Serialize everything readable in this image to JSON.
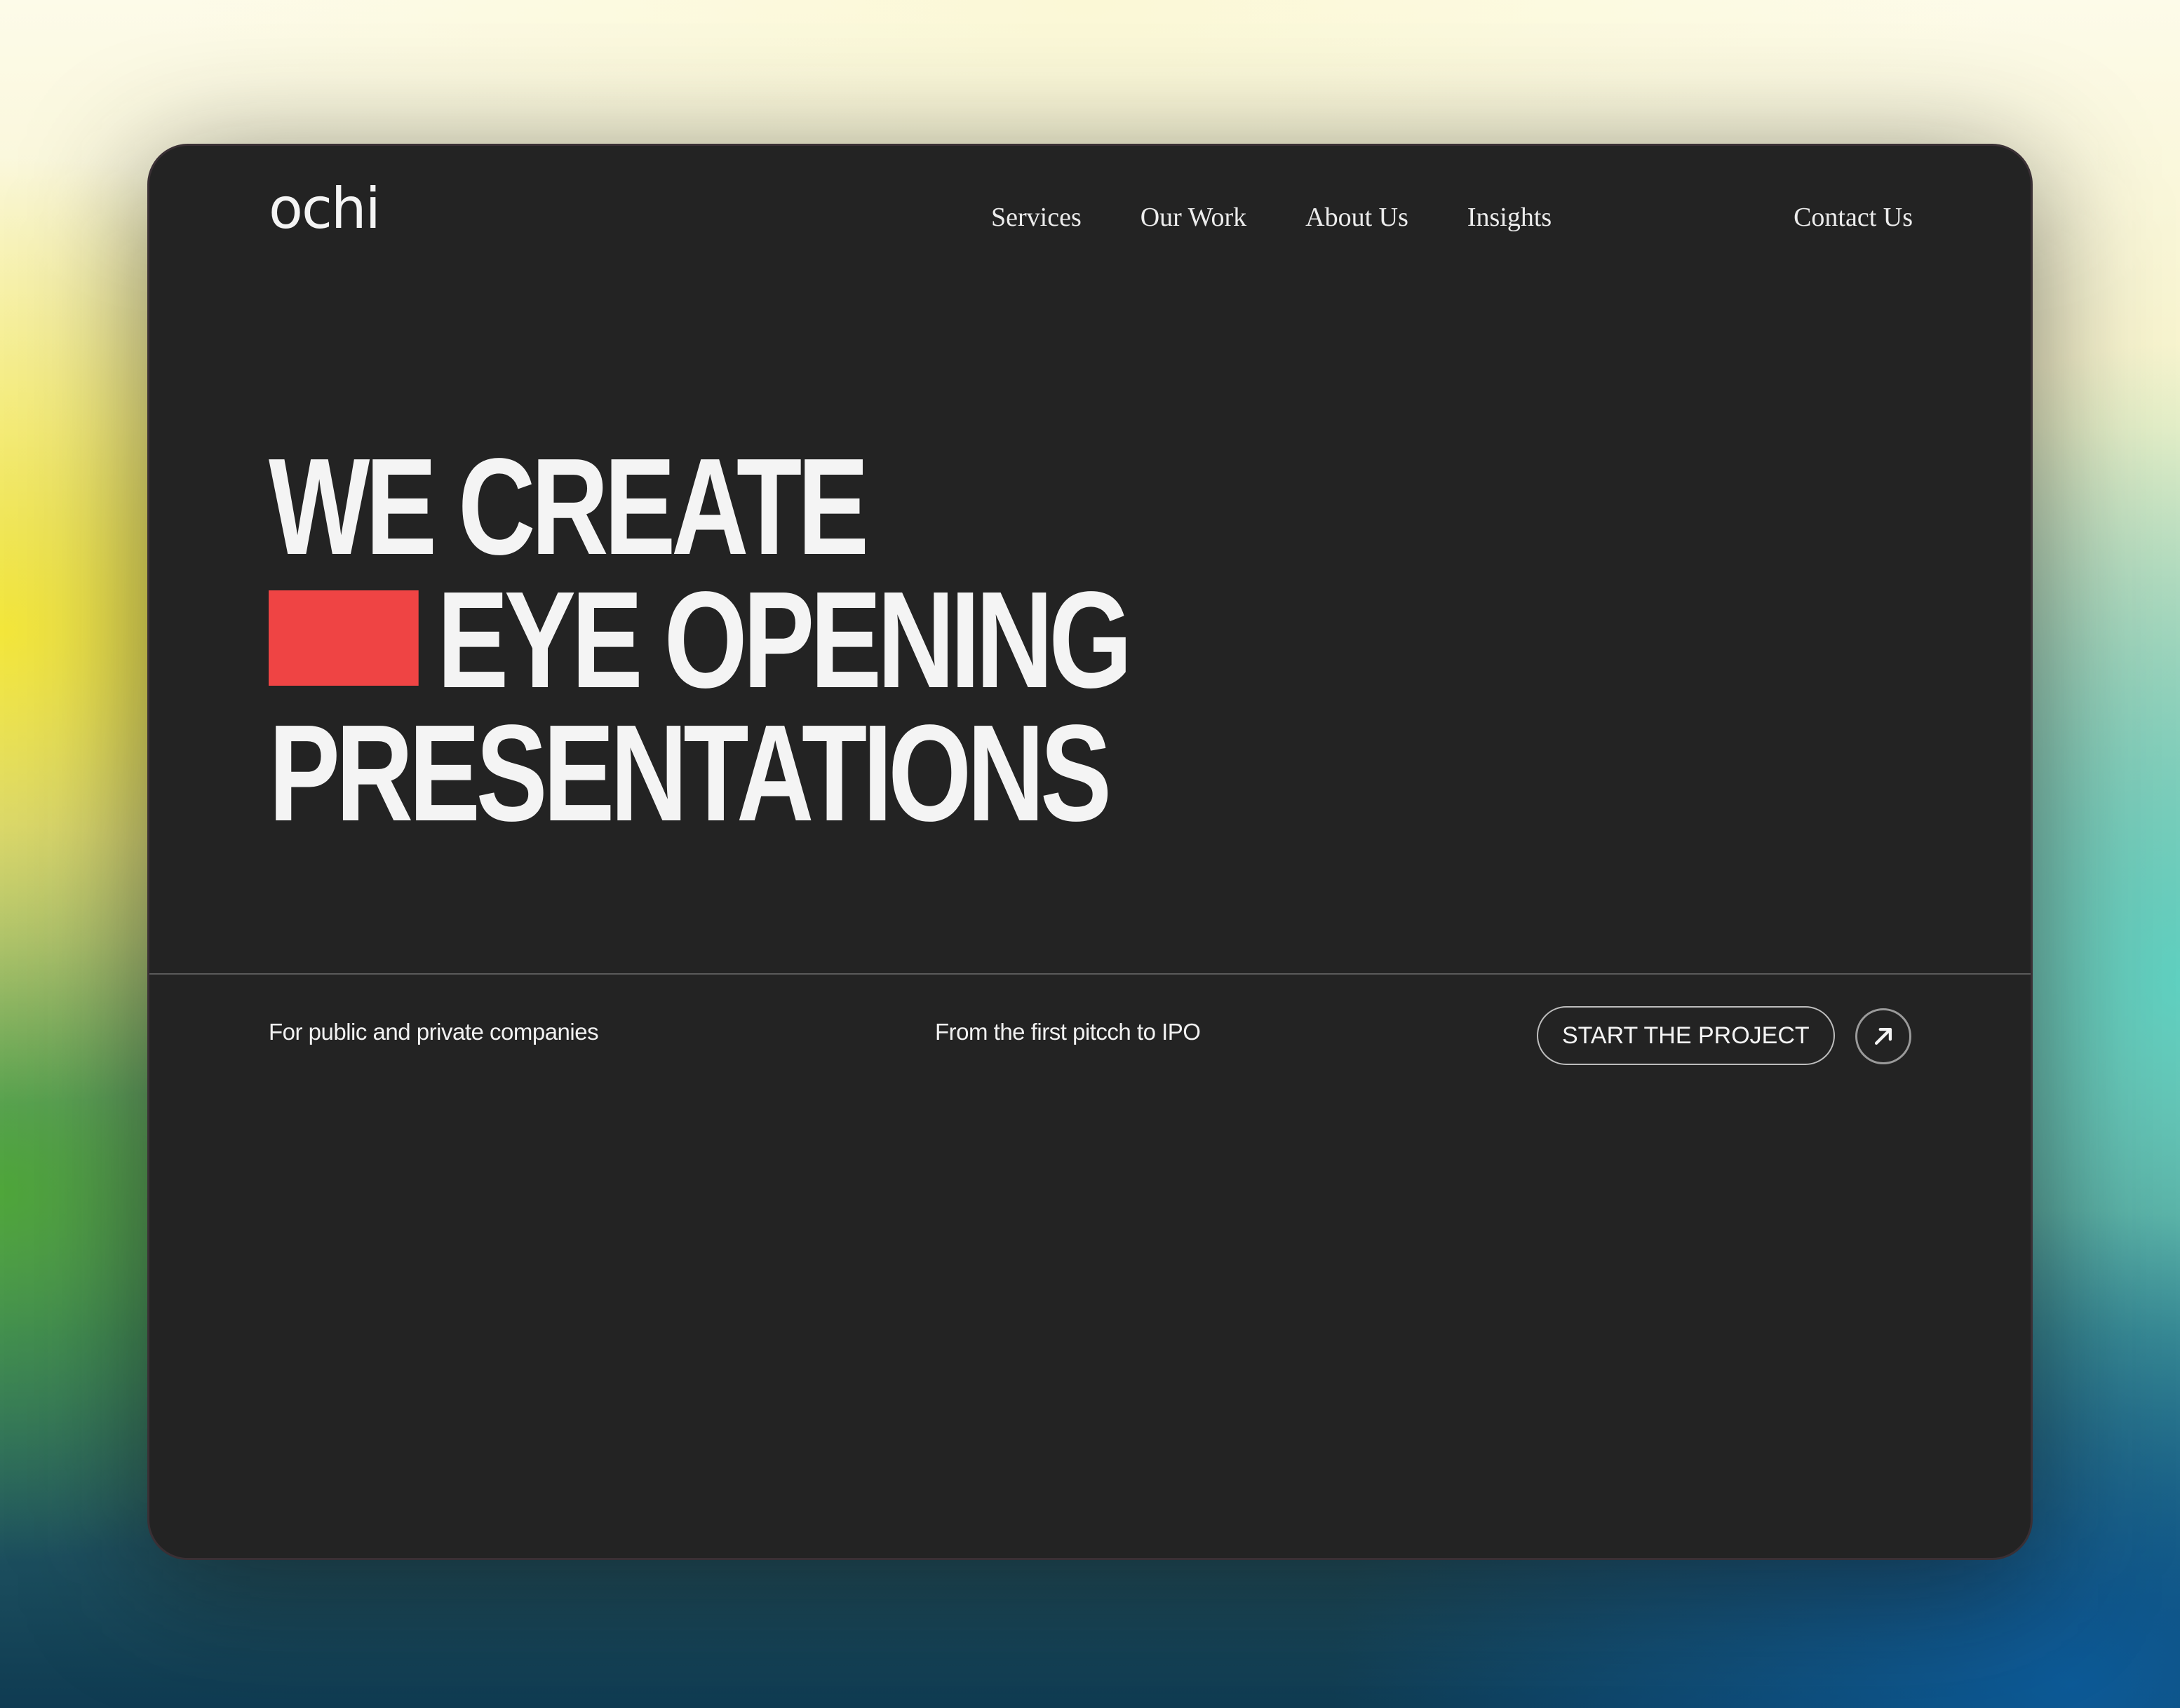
{
  "brand": {
    "logo_text": "ochi"
  },
  "nav": {
    "items": [
      {
        "label": "Services"
      },
      {
        "label": "Our Work"
      },
      {
        "label": "About Us"
      },
      {
        "label": "Insights"
      }
    ],
    "contact_label": "Contact Us"
  },
  "hero": {
    "line1": "WE CREATE",
    "line2": "EYE OPENING",
    "line3": "PRESENTATIONS",
    "accent_color": "#ef4444"
  },
  "footer_bar": {
    "left_text": "For public and private companies",
    "middle_text": "From the first pitcch to IPO",
    "cta_label": "START THE PROJECT",
    "cta_icon": "arrow-up-right-icon"
  },
  "colors": {
    "window_bg": "#232323",
    "text": "#f4f4f4",
    "accent": "#ef4444"
  }
}
